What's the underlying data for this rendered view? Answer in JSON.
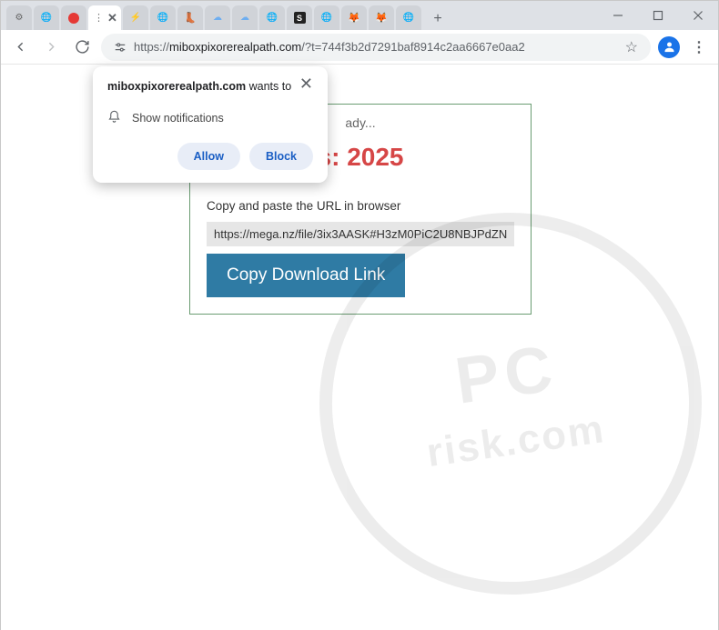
{
  "window": {
    "tabs": [
      {
        "type": "gear"
      },
      {
        "type": "globe"
      },
      {
        "type": "circle-red"
      },
      {
        "type": "active"
      },
      {
        "type": "bolt"
      },
      {
        "type": "globe"
      },
      {
        "type": "boot"
      },
      {
        "type": "cloud"
      },
      {
        "type": "cloud"
      },
      {
        "type": "globe"
      },
      {
        "type": "square-s"
      },
      {
        "type": "globe"
      },
      {
        "type": "fox"
      },
      {
        "type": "fox"
      },
      {
        "type": "globe"
      }
    ],
    "newtab": "+"
  },
  "toolbar": {
    "tune_text": "",
    "url_prefix": "https://",
    "url_host": "miboxpixorerealpath.com",
    "url_rest": "/?t=744f3b2d7291baf8914c2aa6667e0aa2",
    "star": "☆",
    "menu": "⋮"
  },
  "popup": {
    "domain": "miboxpixorerealpath.com",
    "suffix": " wants to",
    "permission": "Show notifications",
    "allow": "Allow",
    "block": "Block",
    "close": "✕"
  },
  "card": {
    "ready_suffix": "ady...",
    "title_visible_right": "s: 2025",
    "hint": "Copy and paste the URL in browser",
    "url": "https://mega.nz/file/3ix3AASK#H3zM0PiC2U8NBJPdZN",
    "copy_btn": "Copy Download Link"
  },
  "watermark": {
    "top": "PC",
    "bottom": "risk.com"
  },
  "colors": {
    "accent_red": "#d64646",
    "card_border": "#6a9c72",
    "copy_btn": "#2f7ba4",
    "perm_btn_bg": "#e8edf7",
    "perm_btn_fg": "#1a5ec4"
  }
}
